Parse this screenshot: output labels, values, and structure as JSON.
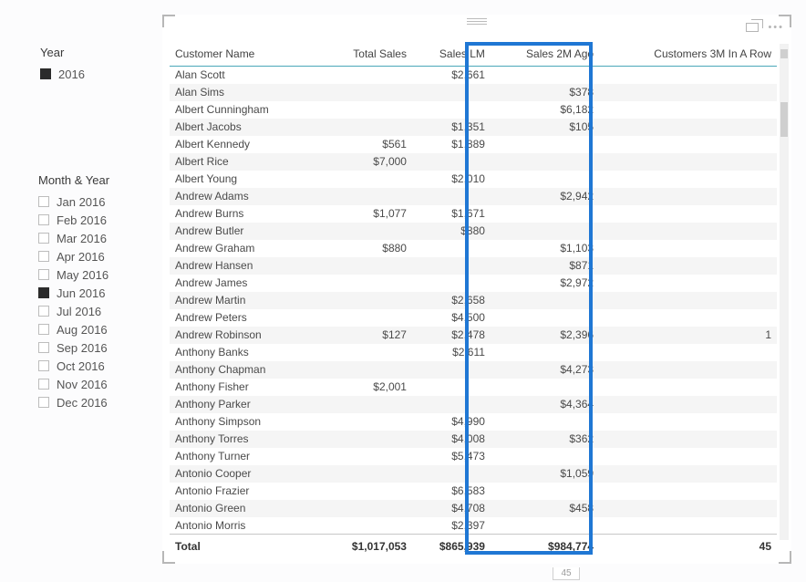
{
  "slicers": {
    "year": {
      "title": "Year",
      "items": [
        {
          "label": "2016",
          "checked": true
        }
      ]
    },
    "month": {
      "title": "Month & Year",
      "items": [
        {
          "label": "Jan 2016",
          "checked": false
        },
        {
          "label": "Feb 2016",
          "checked": false
        },
        {
          "label": "Mar 2016",
          "checked": false
        },
        {
          "label": "Apr 2016",
          "checked": false
        },
        {
          "label": "May 2016",
          "checked": false
        },
        {
          "label": "Jun 2016",
          "checked": true
        },
        {
          "label": "Jul 2016",
          "checked": false
        },
        {
          "label": "Aug 2016",
          "checked": false
        },
        {
          "label": "Sep 2016",
          "checked": false
        },
        {
          "label": "Oct 2016",
          "checked": false
        },
        {
          "label": "Nov 2016",
          "checked": false
        },
        {
          "label": "Dec 2016",
          "checked": false
        }
      ]
    }
  },
  "table": {
    "columns": [
      "Customer Name",
      "Total Sales",
      "Sales LM",
      "Sales 2M Ago",
      "Customers 3M In A Row"
    ],
    "rows": [
      {
        "name": "Alan Scott",
        "total": "",
        "lm": "$2,661",
        "m2": "",
        "c3": ""
      },
      {
        "name": "Alan Sims",
        "total": "",
        "lm": "",
        "m2": "$378",
        "c3": ""
      },
      {
        "name": "Albert Cunningham",
        "total": "",
        "lm": "",
        "m2": "$6,182",
        "c3": ""
      },
      {
        "name": "Albert Jacobs",
        "total": "",
        "lm": "$1,351",
        "m2": "$105",
        "c3": ""
      },
      {
        "name": "Albert Kennedy",
        "total": "$561",
        "lm": "$1,889",
        "m2": "",
        "c3": ""
      },
      {
        "name": "Albert Rice",
        "total": "$7,000",
        "lm": "",
        "m2": "",
        "c3": ""
      },
      {
        "name": "Albert Young",
        "total": "",
        "lm": "$2,010",
        "m2": "",
        "c3": ""
      },
      {
        "name": "Andrew Adams",
        "total": "",
        "lm": "",
        "m2": "$2,942",
        "c3": ""
      },
      {
        "name": "Andrew Burns",
        "total": "$1,077",
        "lm": "$1,671",
        "m2": "",
        "c3": ""
      },
      {
        "name": "Andrew Butler",
        "total": "",
        "lm": "$880",
        "m2": "",
        "c3": ""
      },
      {
        "name": "Andrew Graham",
        "total": "$880",
        "lm": "",
        "m2": "$1,103",
        "c3": ""
      },
      {
        "name": "Andrew Hansen",
        "total": "",
        "lm": "",
        "m2": "$871",
        "c3": ""
      },
      {
        "name": "Andrew James",
        "total": "",
        "lm": "",
        "m2": "$2,972",
        "c3": ""
      },
      {
        "name": "Andrew Martin",
        "total": "",
        "lm": "$2,658",
        "m2": "",
        "c3": ""
      },
      {
        "name": "Andrew Peters",
        "total": "",
        "lm": "$4,500",
        "m2": "",
        "c3": ""
      },
      {
        "name": "Andrew Robinson",
        "total": "$127",
        "lm": "$2,478",
        "m2": "$2,396",
        "c3": "1"
      },
      {
        "name": "Anthony Banks",
        "total": "",
        "lm": "$2,611",
        "m2": "",
        "c3": ""
      },
      {
        "name": "Anthony Chapman",
        "total": "",
        "lm": "",
        "m2": "$4,273",
        "c3": ""
      },
      {
        "name": "Anthony Fisher",
        "total": "$2,001",
        "lm": "",
        "m2": "",
        "c3": ""
      },
      {
        "name": "Anthony Parker",
        "total": "",
        "lm": "",
        "m2": "$4,364",
        "c3": ""
      },
      {
        "name": "Anthony Simpson",
        "total": "",
        "lm": "$4,990",
        "m2": "",
        "c3": ""
      },
      {
        "name": "Anthony Torres",
        "total": "",
        "lm": "$4,008",
        "m2": "$362",
        "c3": ""
      },
      {
        "name": "Anthony Turner",
        "total": "",
        "lm": "$5,473",
        "m2": "",
        "c3": ""
      },
      {
        "name": "Antonio Cooper",
        "total": "",
        "lm": "",
        "m2": "$1,059",
        "c3": ""
      },
      {
        "name": "Antonio Frazier",
        "total": "",
        "lm": "$6,583",
        "m2": "",
        "c3": ""
      },
      {
        "name": "Antonio Green",
        "total": "",
        "lm": "$4,708",
        "m2": "$458",
        "c3": ""
      },
      {
        "name": "Antonio Morris",
        "total": "",
        "lm": "$2,397",
        "m2": "",
        "c3": ""
      }
    ],
    "totals": {
      "label": "Total",
      "total": "$1,017,053",
      "lm": "$865,939",
      "m2": "$984,774",
      "c3": "45"
    }
  },
  "page_ticker": "45"
}
